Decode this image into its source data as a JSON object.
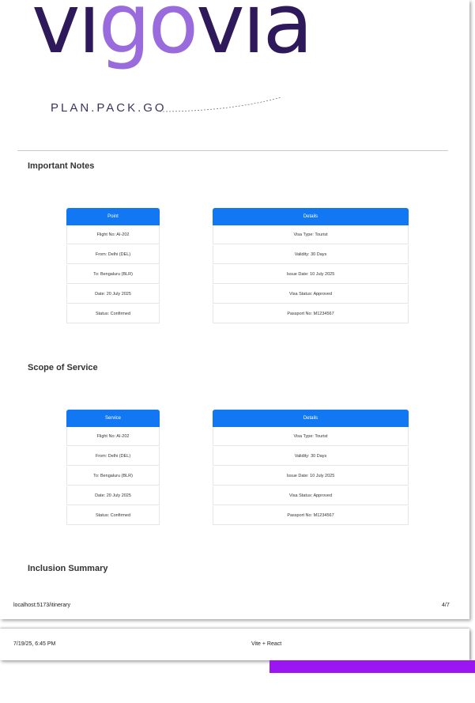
{
  "logo": {
    "part1": "vi",
    "part2": "go",
    "part3": "via"
  },
  "tagline": "PLAN.PACK.GO",
  "sections": [
    {
      "title": "Important Notes",
      "left_header": "Point",
      "left_rows": [
        "Flight No: AI-202",
        "From: Delhi (DEL)",
        "To: Bengaluru (BLR)",
        "Date: 20 July 2025",
        "Status: Confirmed"
      ],
      "right_header": "Details",
      "right_rows": [
        "Visa Type: Tourist",
        "Validity: 30 Days",
        "Issue Date: 10 July 2025",
        "Visa Status: Approved",
        "Passport No: M1234567"
      ]
    },
    {
      "title": "Scope of Service",
      "left_header": "Service",
      "left_rows": [
        "Flight No: AI-202",
        "From: Delhi (DEL)",
        "To: Bengaluru (BLR)",
        "Date: 20 July 2025",
        "Status: Confirmed"
      ],
      "right_header": "Details",
      "right_rows": [
        "Visa Type: Tourist",
        "Validity: 30 Days",
        "Issue Date: 10 July 2025",
        "Visa Status: Approved",
        "Passport No: M1234567"
      ]
    },
    {
      "title": "Inclusion Summary"
    }
  ],
  "footer": {
    "url": "localhost:5173/itinerary",
    "page": "4/7"
  },
  "header2": {
    "datetime": "7/19/25, 6:45 PM",
    "title": "Vite + React"
  }
}
